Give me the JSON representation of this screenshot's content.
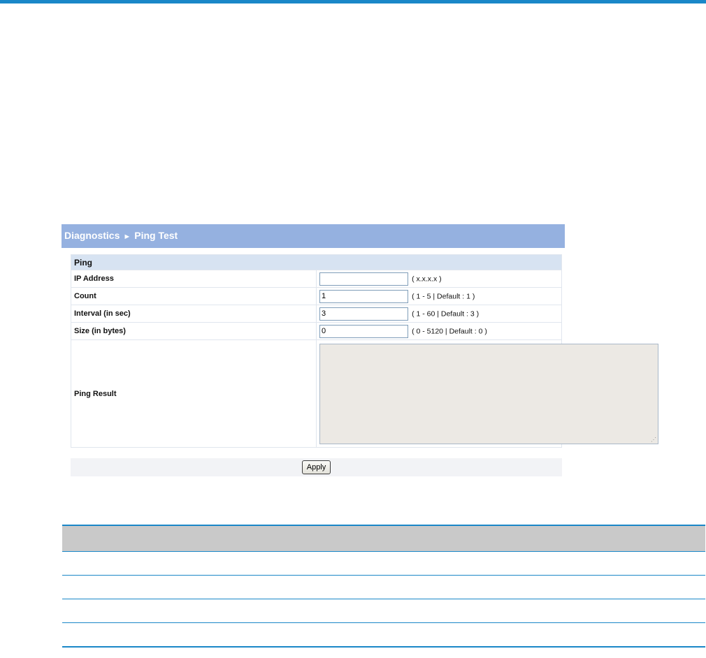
{
  "panel": {
    "breadcrumb_parent": "Diagnostics",
    "breadcrumb_separator": "►",
    "breadcrumb_current": "Ping Test"
  },
  "ping": {
    "section_label": "Ping",
    "fields": [
      {
        "label": "IP Address",
        "value": "",
        "hint": "( x.x.x.x )"
      },
      {
        "label": "Count",
        "value": "1",
        "hint": "( 1 - 5 | Default : 1 )"
      },
      {
        "label": "Interval (in sec)",
        "value": "3",
        "hint": "( 1 - 60 | Default : 3 )"
      },
      {
        "label": "Size (in bytes)",
        "value": "0",
        "hint": "( 0 - 5120 | Default : 0 )"
      }
    ],
    "result_label": "Ping Result",
    "result_value": ""
  },
  "actions": {
    "apply_label": "Apply"
  },
  "colors": {
    "top_rule": "#1a87c8",
    "panel_title_bg": "#95b1e0",
    "section_bg": "#d7e3f2",
    "table_rule": "#1a87c8",
    "table_header_bg": "#c9c9c9"
  }
}
